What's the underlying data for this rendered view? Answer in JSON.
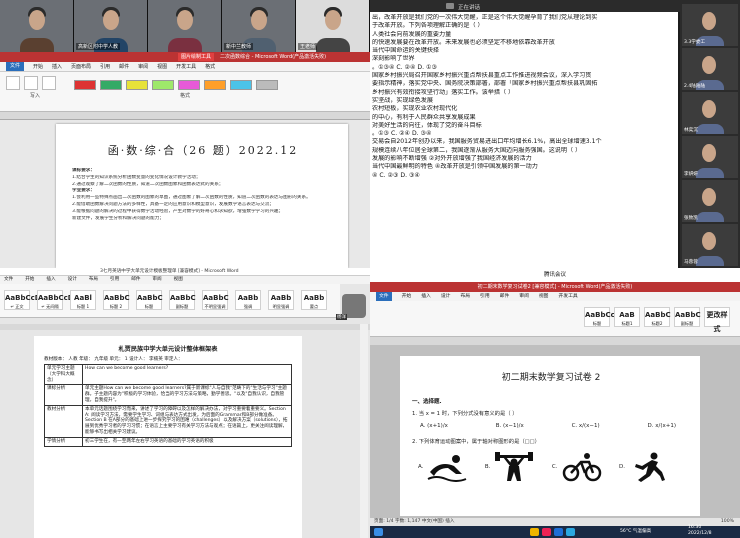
{
  "q1": {
    "participants": [
      "",
      "高新区附中学人教",
      "",
      "新中兰教师",
      "王老师"
    ],
    "word_title": "二次函数综合 - Microsoft Word(产品激活失败)",
    "title_badge": "图片绘制工具",
    "menu": [
      "文件",
      "开始",
      "插入",
      "页面布局",
      "引用",
      "邮件",
      "审阅",
      "视图",
      "开发工具",
      "格式"
    ],
    "ribbon_labels": [
      "写入",
      "格式"
    ],
    "doc_title": "函·数·综·合（26 题）2022.12",
    "doc_lines": [
      {
        "t": "课标要求：",
        "b": true
      },
      {
        "t": "1.结合学生的知识系统分析函数变量的变化情况设计教学活动；",
        "b": false
      },
      {
        "t": "2.通过观察了解二次函数的性质，知道二次函数图象和函数表达式的关系；",
        "b": false
      },
      {
        "t": "学业要求：",
        "b": true
      },
      {
        "t": "1.会利用一些特殊点画出二次函数的图象的草图，通过图象了解二次函数的性质，知道二次函数的表达与图形的关系。",
        "b": false
      },
      {
        "t": "2.能借助函数解决问题方法的多样性，具备一定的应用意识和模型意识，发展数学语言表达与交流；",
        "b": false
      },
      {
        "t": "3.能根据问题的解决的过程中获得数学活动经验，产生对数学的好奇心和求知欲，增强数学学习的兴趣；",
        "b": false
      },
      {
        "t": "新建文件，发展学生分析和解决问题的能力；",
        "b": false
      }
    ]
  },
  "q2": {
    "speaking": "正在讲话",
    "doc_lines": [
      "出，改革开放是我们党的一次伟大觉醒，正是这个伟大觉醒孕育了我们党从理论到实",
      "于改革开放。下列各项理解正确的是（ ）",
      "人类社会向前发展的重要力量",
      "的快速发展要在改革开放。未来发展也必须坚定不移地依靠改革开放",
      "当代中国命运的关键抉择",
      "深刻影响了世界",
      "。①③④         C. ②④        D. ①③",
      "",
      "国家乡村振兴局召开国家乡村振兴重点帮扶县重点工作推进视频会议，深入学习贯",
      "要指示精神，落实党中央、国务院决策部署，部署「国家乡村振兴重点帮扶县巩固拓",
      "乡村振兴有效衔接攻坚行动」落实工作。该举措（ ）",
      "实坚战，实现绿色发展",
      "农村短板，实现农业农村现代化",
      "的中心，有利于人民群众共享发展成果",
      "对美好生活的向往，体现了党的奋斗目标",
      "。①③        C. ②④        D. ③④",
      "",
      "交易会自2012年创办以来，我国服务贸易进出口年均增长6.1%，高出全球增速3.1个",
      "规模连续八年位居全球第二，我国逐渐从服务大国迈向服务强国。这说明（ ）",
      "发展的影响不断增强              ②对外开放增强了我国经济发展的活力",
      "当代中国最鲜明的特色           ④改革开放是引领中国发展的第一动力",
      "④    C. ②③      D. ③④"
    ],
    "side_names": [
      "3.3学委工",
      "2.4陆陆陆",
      "林奕沉",
      "李妍妍",
      "张致凯",
      "马蓉蓉"
    ]
  },
  "q3": {
    "doc_title": "3七月英语中学大单元设计模板整理单 [兼容模式] - Microsoft Word",
    "menu": [
      "文件",
      "开始",
      "插入",
      "设计",
      "布局",
      "引用",
      "邮件",
      "审阅",
      "视图"
    ],
    "styles": [
      {
        "big": "AaBbCcDd",
        "small": "↵ 正文"
      },
      {
        "big": "AaBbCcDd",
        "small": "↵ 无间隔"
      },
      {
        "big": "AaBl",
        "small": "标题 1"
      },
      {
        "big": "AaBbC",
        "small": "标题 2"
      },
      {
        "big": "AaBbC",
        "small": "标题"
      },
      {
        "big": "AaBbC",
        "small": "副标题"
      },
      {
        "big": "AaBbC",
        "small": "不明显强调"
      },
      {
        "big": "AaBb",
        "small": "强调"
      },
      {
        "big": "AaBb",
        "small": "明显强调"
      },
      {
        "big": "AaBb",
        "small": "要点"
      }
    ],
    "avatar_name": "杨洋",
    "page_title": "札贾民族中学大单元设计整体框架表",
    "meta": "教材版本：  人教  年级：  九年级  单元：  1  设计人：   李楠英  审定人：",
    "rows": [
      {
        "h": "单元学习主题（大学科大概念）",
        "c": "How can we become good learners?"
      },
      {
        "h": "课标分析",
        "c": "单元主题How can we become good learners?属于新课标\"人与自我\"范畴下的\"生活与学习\"主题群。子主题内容为\"积极的学习体验，恰当的学习方法与策略，勤学善思。\"以及\"自我认识，自我管理，自我提升\"。"
      },
      {
        "h": "教材分析",
        "c": "本单元话题围绕学习而来，讲述了学习的障碍以及怎样的解决办法，对学习重要着重要义。Section A: 阅读学习方法，需要学生学习、词组与表达方式出发，为后面的Grammar和B部分做准备。Section B 在A部分的基础上进一步探究学习的困难（challenges）以及解决方案（solutions），拓展到优秀学习者的学习习惯；在语言上主要学习有关学习方法与观点；在语篇上，更关注阅读理解，能够书写出相关学习建议。"
      },
      {
        "h": "学情分析",
        "c": "初三学生在，有一至两年左右学习英语的基础的学习英语的积极"
      }
    ]
  },
  "q4": {
    "meeting_title": "腾讯会议",
    "doc_title": "初二期末数学复习试卷2 [兼容模式] - Microsoft Word(产品激活失败)",
    "menu": [
      "文件",
      "开始",
      "插入",
      "设计",
      "布局",
      "引用",
      "邮件",
      "审阅",
      "视图",
      "开发工具"
    ],
    "styles": [
      {
        "big": "AaBbCcDd",
        "small": "标题"
      },
      {
        "big": "AaB",
        "small": "标题1"
      },
      {
        "big": "AaBbC",
        "small": "标题2"
      },
      {
        "big": "AaBbC",
        "small": "副标题"
      },
      {
        "big": "更改样式",
        "small": ""
      }
    ],
    "page_title": "初二期末数学复习试卷 2",
    "section": "一、选择题.",
    "q1": "1. 当 x = 1 时，下列分式没有意义的是（  ）",
    "choices": [
      "A. (x+1)/x",
      "B. (x−1)/x",
      "C. x/(x−1)",
      "D. x/(x+1)"
    ],
    "q2": "2. 下列体育运动图案中，属于轴对称图形的是（□□）",
    "icon_labels": [
      "A.",
      "B.",
      "C.",
      "D."
    ],
    "status": "页面: 1/4  字数: 1,147  中文(中国)  插入",
    "zoom": "100%",
    "weather": "56°C  气温偏高",
    "time": "16:30",
    "date": "2022/12/8"
  }
}
